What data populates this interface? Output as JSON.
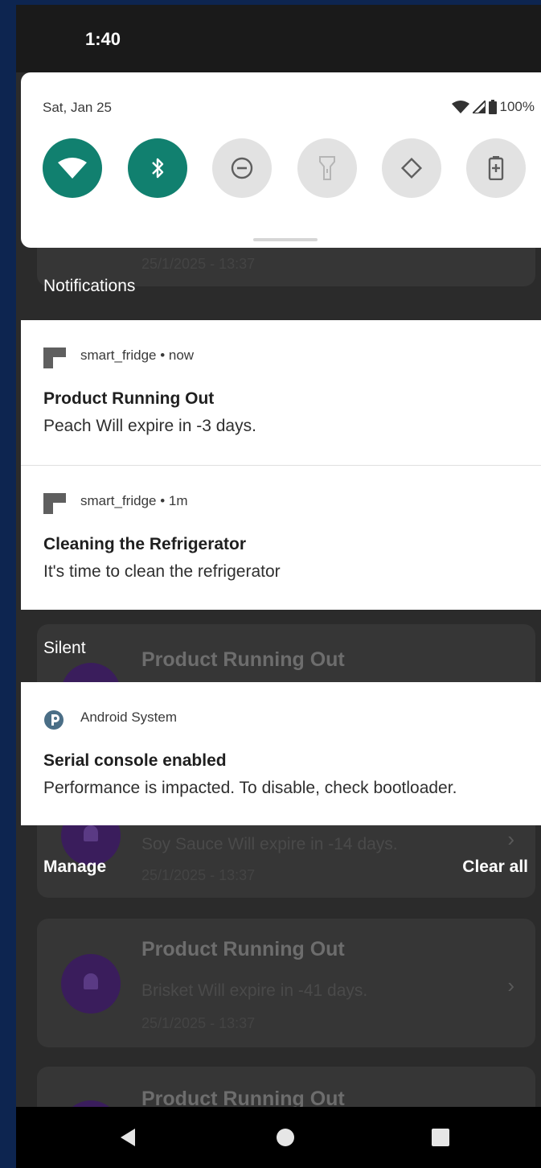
{
  "status_bar": {
    "time": "1:40"
  },
  "quick_settings": {
    "date": "Sat, Jan 25",
    "battery": "100%",
    "tiles": [
      {
        "name": "wifi-tile",
        "icon": "wifi-icon",
        "state": "on"
      },
      {
        "name": "bluetooth-tile",
        "icon": "bluetooth-icon",
        "state": "on"
      },
      {
        "name": "dnd-tile",
        "icon": "do-not-disturb-icon",
        "state": "off"
      },
      {
        "name": "flashlight-tile",
        "icon": "flashlight-icon",
        "state": "off"
      },
      {
        "name": "auto-rotate-tile",
        "icon": "rotate-icon",
        "state": "off"
      },
      {
        "name": "battery-saver-tile",
        "icon": "battery-saver-icon",
        "state": "off"
      }
    ],
    "accent_color": "#11806f"
  },
  "notifications_label": "Notifications",
  "notifications": [
    {
      "app": "smart_fridge",
      "time": "now",
      "title": "Product Running Out",
      "text": "Peach Will expire in -3 days."
    },
    {
      "app": "smart_fridge",
      "time": "1m",
      "title": "Cleaning the Refrigerator",
      "text": "It's time to clean the refrigerator"
    }
  ],
  "silent_label": "Silent",
  "silent_notification": {
    "app": "Android System",
    "title": "Serial console enabled",
    "text": "Performance is impacted. To disable, check bootloader."
  },
  "footer": {
    "manage": "Manage",
    "clear_all": "Clear all"
  },
  "background_app": {
    "card1_date": "25/1/2025 - 13:37",
    "card2_title": "Product Running Out",
    "card2_text": "Soy Sauce Will expire in -14 days.",
    "card2_date": "25/1/2025 - 13:37",
    "card3_title": "Product Running Out",
    "card3_text": "Brisket Will expire in -41 days.",
    "card3_date": "25/1/2025 - 13:37",
    "card4_title": "Product Running Out"
  }
}
